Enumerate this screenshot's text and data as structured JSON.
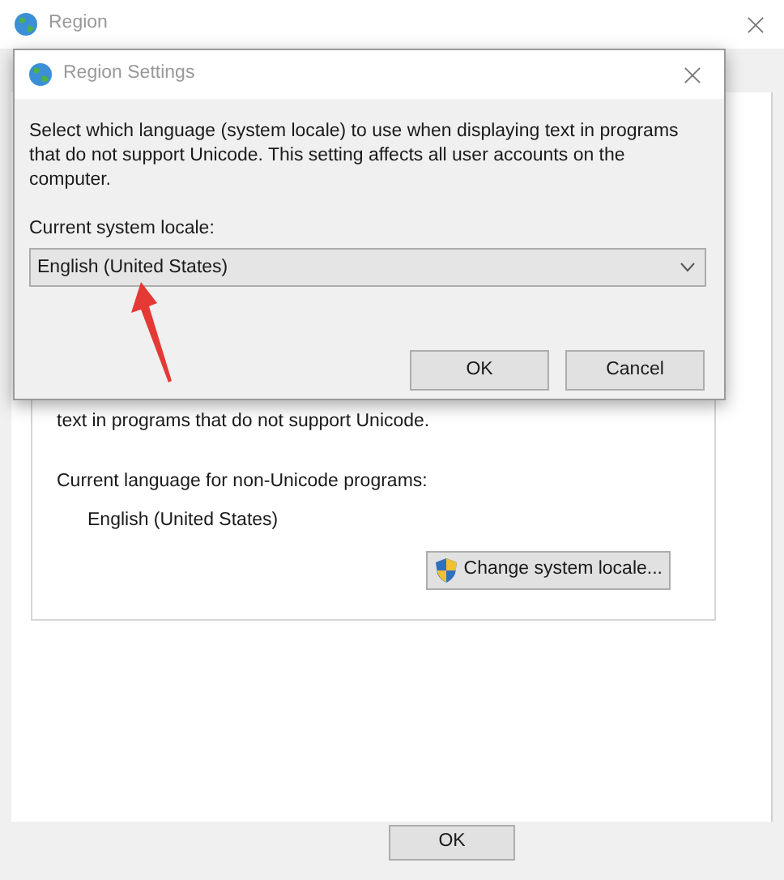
{
  "window": {
    "title": "Region"
  },
  "background_panel": {
    "description": "text in programs that do not support Unicode.",
    "current_label": "Current language for non-Unicode programs:",
    "current_value": "English (United States)",
    "change_button": "Change system locale..."
  },
  "buttons": [
    "OK"
  ],
  "dialog": {
    "title": "Region Settings",
    "description": "Select which language (system locale) to use when displaying text in programs that do not support Unicode. This setting affects all user accounts on the computer.",
    "locale_label": "Current system locale:",
    "locale_value": "English (United States)",
    "buttons": [
      "OK",
      "Cancel"
    ]
  }
}
